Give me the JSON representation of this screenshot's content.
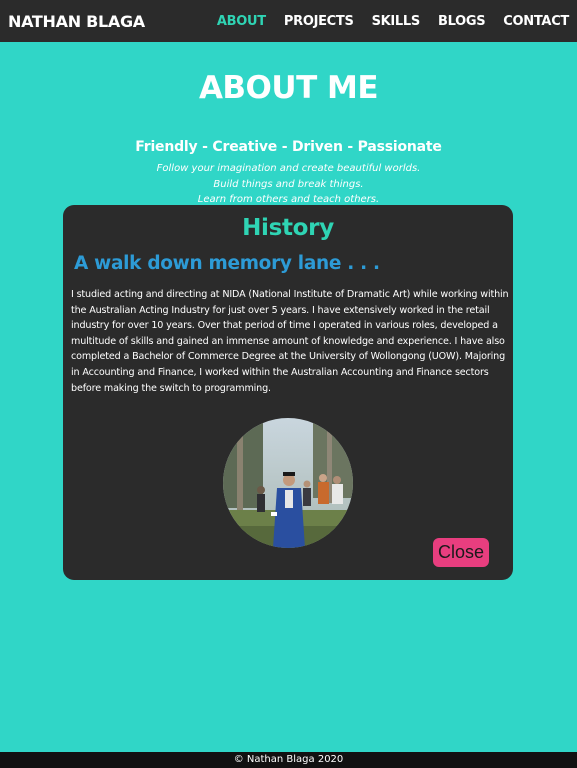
{
  "nav": {
    "brand": "NATHAN BLAGA",
    "links": [
      "ABOUT",
      "PROJECTS",
      "SKILLS",
      "BLOGS",
      "CONTACT"
    ],
    "active_index": 0
  },
  "hero": {
    "title": "ABOUT ME",
    "tagline": "Friendly - Creative - Driven - Passionate",
    "motto": [
      "Follow your imagination and create beautiful worlds.",
      "Build things and break things.",
      "Learn from others and teach others."
    ]
  },
  "modal": {
    "title": "History",
    "subtitle": "A walk down memory lane . . .",
    "body": "I studied acting and directing at NIDA (National Institute of Dramatic Art) while working within the Australian Acting Industry for just over 5 years. I have extensively worked in the retail industry for over 10 years. Over that period of time I operated in various roles, developed a multitude of skills and gained an immense amount of knowledge and experience. I have also completed a Bachelor of Commerce Degree at the University of Wollongong (UOW). Majoring in Accounting and Finance, I worked within the Australian Accounting and Finance sectors before making the switch to programming.",
    "close_label": "Close"
  },
  "footer": {
    "text": "© Nathan Blaga 2020"
  },
  "colors": {
    "background": "#30d6c7",
    "navbar": "#2b2b2b",
    "accent_teal": "#2fd4b4",
    "accent_blue": "#2d9bd6",
    "close_button": "#e83e7f"
  }
}
